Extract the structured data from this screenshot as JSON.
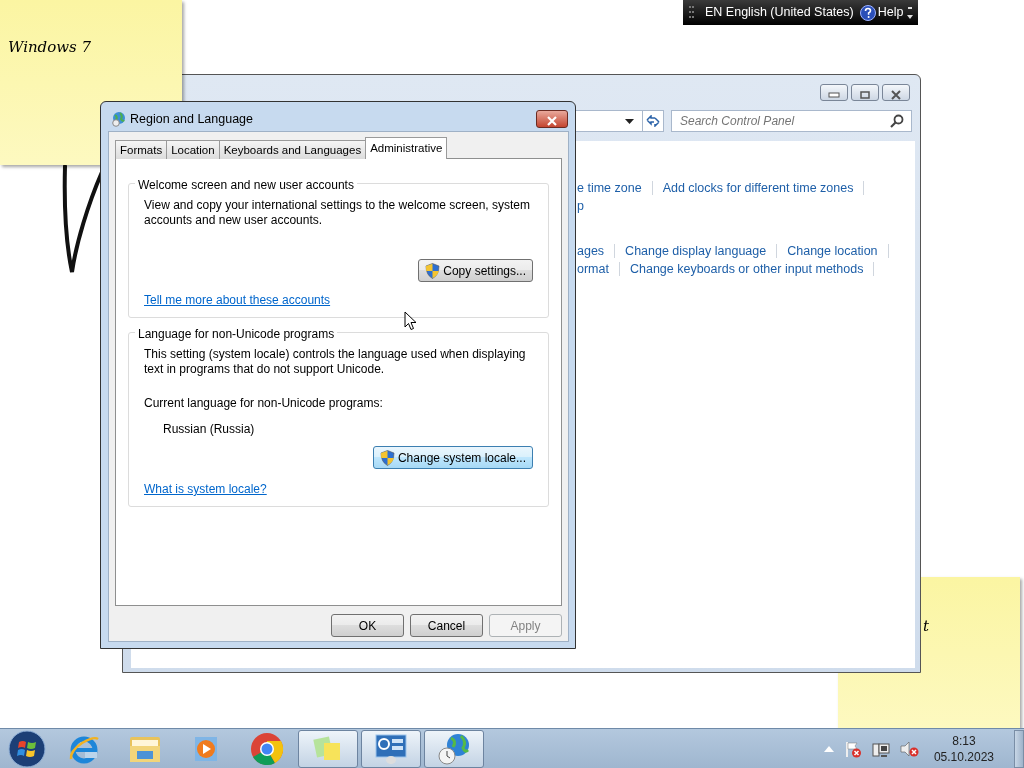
{
  "sticky_notes": [
    {
      "text": "Windows 7"
    },
    {
      "text": "t"
    }
  ],
  "language_bar": {
    "language": "EN English (United States)",
    "help": "Help"
  },
  "control_panel": {
    "search": {
      "placeholder": "Search Control Panel"
    },
    "link_rows": [
      [
        "e time zone",
        "Add clocks for different time zones"
      ],
      [
        "p"
      ],
      [
        "ages",
        "Change display language",
        "Change location"
      ],
      [
        "ormat",
        "Change keyboards or other input methods"
      ]
    ]
  },
  "dialog": {
    "title": "Region and Language",
    "tabs": [
      {
        "label": "Formats",
        "selected": false
      },
      {
        "label": "Location",
        "selected": false
      },
      {
        "label": "Keyboards and Languages",
        "selected": false
      },
      {
        "label": "Administrative",
        "selected": true
      }
    ],
    "groups": [
      {
        "title": "Welcome screen and new user accounts",
        "text": "View and copy your international settings to the welcome screen, system accounts and new user accounts.",
        "button": {
          "label": "Copy settings...",
          "focused": false
        },
        "link": "Tell me more about these accounts"
      },
      {
        "title": "Language for non-Unicode programs",
        "text": "This setting (system locale) controls the language used when displaying text in programs that do not support Unicode.",
        "current_label": "Current language for non-Unicode programs:",
        "current_value": "Russian (Russia)",
        "button": {
          "label": "Change system locale...",
          "focused": true
        },
        "link": "What is system locale?"
      }
    ],
    "buttons": [
      {
        "label": "OK",
        "disabled": false
      },
      {
        "label": "Cancel",
        "disabled": false
      },
      {
        "label": "Apply",
        "disabled": true
      }
    ]
  },
  "taskbar": {
    "items": [
      {
        "kind": "start"
      },
      {
        "kind": "ie",
        "running": false
      },
      {
        "kind": "folder",
        "running": false
      },
      {
        "kind": "media",
        "running": false
      },
      {
        "kind": "chrome",
        "running": false
      },
      {
        "kind": "notes",
        "running": true
      },
      {
        "kind": "panel",
        "running": true
      },
      {
        "kind": "globe",
        "running": true
      }
    ],
    "clock": {
      "time": "8:13",
      "date": "05.10.2023"
    }
  }
}
